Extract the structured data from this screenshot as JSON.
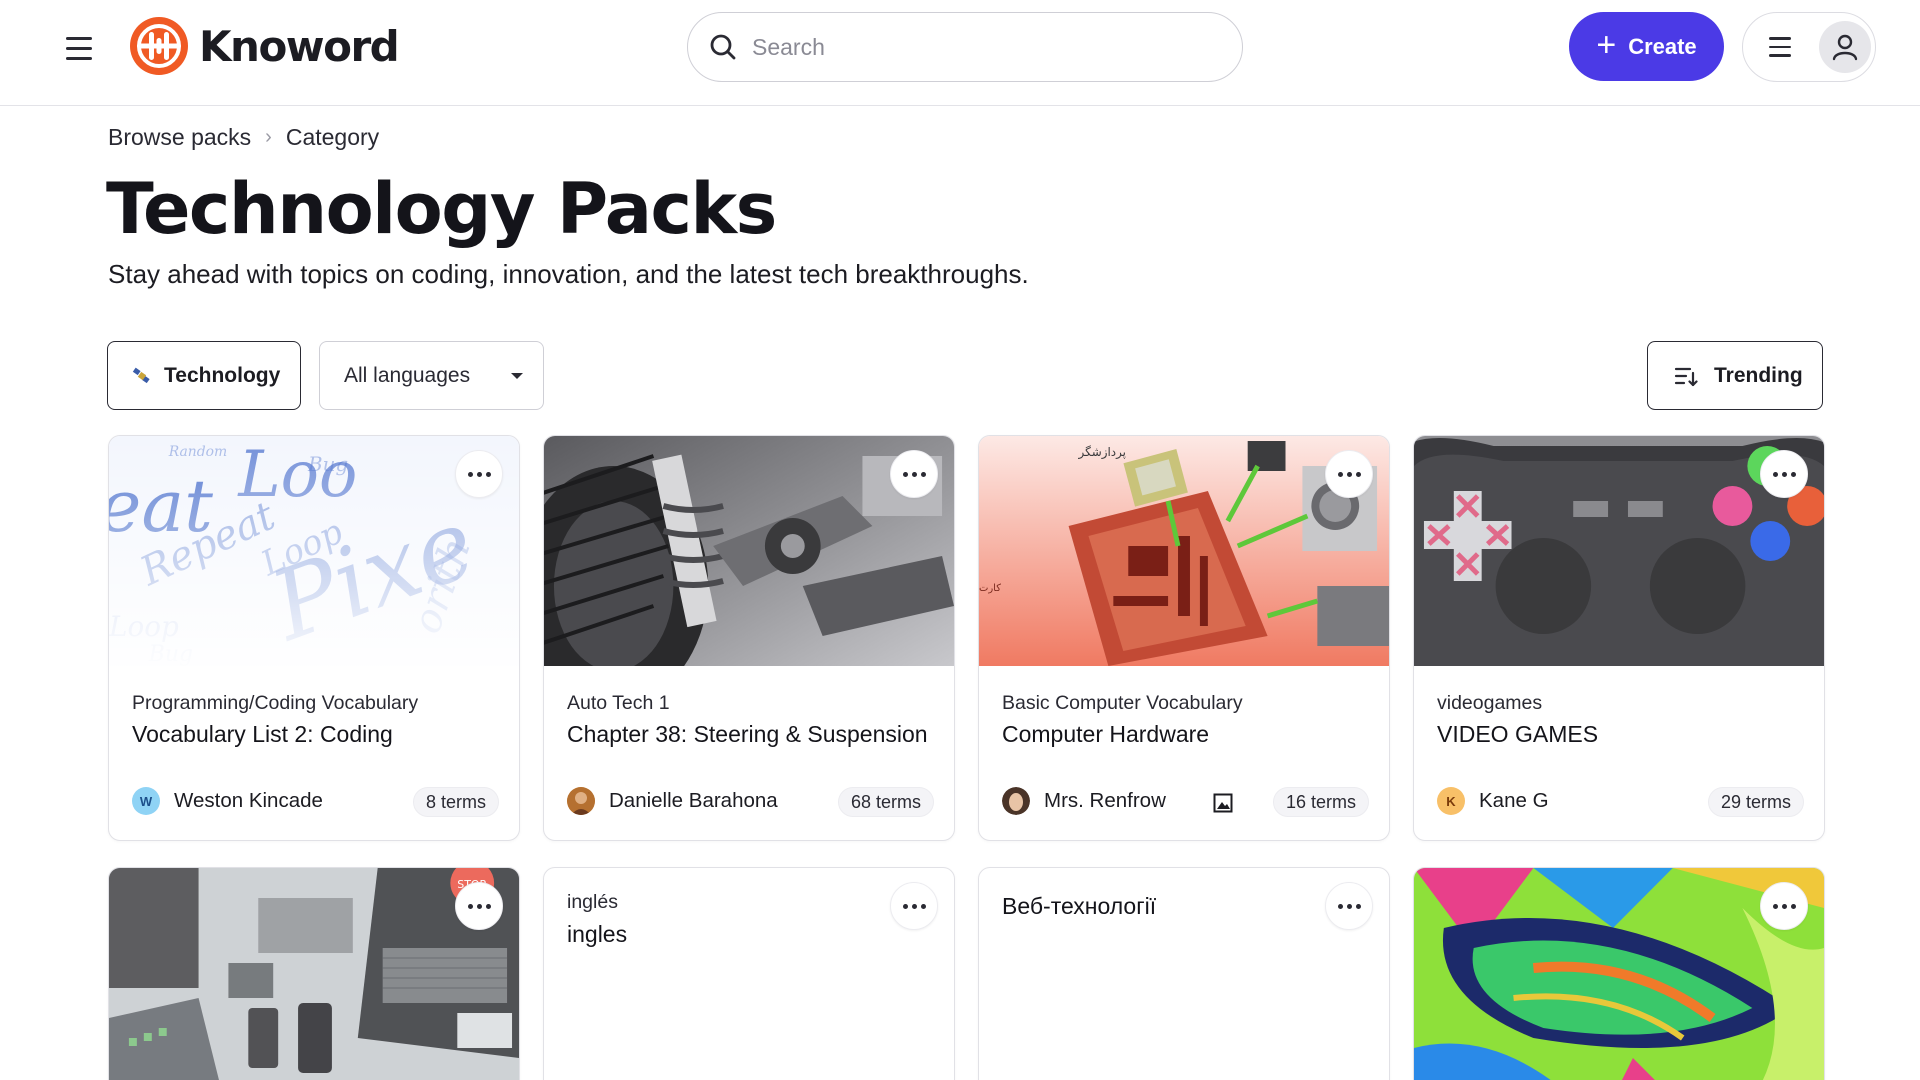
{
  "header": {
    "logo_text": "Knoword",
    "search_placeholder": "Search",
    "create_label": "Create"
  },
  "breadcrumb": [
    "Browse packs",
    "Category"
  ],
  "page": {
    "title": "Technology Packs",
    "subtitle": "Stay ahead with topics on coding, innovation, and the latest tech breakthroughs."
  },
  "filters": {
    "category": "Technology",
    "language": "All languages",
    "sort": "Trending"
  },
  "cards": [
    {
      "subject": "Programming/Coding Vocabulary",
      "title": "Vocabulary List 2: Coding",
      "author": "Weston Kincade",
      "author_initial": "W",
      "terms": "8 terms",
      "thumb": "word-cloud"
    },
    {
      "subject": "Auto Tech 1",
      "title": "Chapter 38: Steering & Suspension",
      "author": "Danielle Barahona",
      "author_initial": "",
      "terms": "68 terms",
      "thumb": "suspension"
    },
    {
      "subject": "Basic Computer Vocabulary",
      "title": "Computer Hardware",
      "author": "Mrs. Renfrow",
      "author_initial": "",
      "terms": "16 terms",
      "thumb": "motherboard",
      "has_image_icon": true
    },
    {
      "subject": "videogames",
      "title": "VIDEO GAMES",
      "author": "Kane G",
      "author_initial": "K",
      "terms": "29 terms",
      "thumb": "controller"
    },
    {
      "subject": "",
      "title": "",
      "thumb": "desk-devices"
    },
    {
      "subject": "inglés",
      "title": "ingles",
      "thumb": "none"
    },
    {
      "subject": "",
      "title": "Веб-технології",
      "thumb": "none"
    },
    {
      "subject": "",
      "title": "",
      "thumb": "colorful-art"
    }
  ],
  "colors": {
    "accent": "#4b3ae6",
    "logo": "#f05a24"
  }
}
